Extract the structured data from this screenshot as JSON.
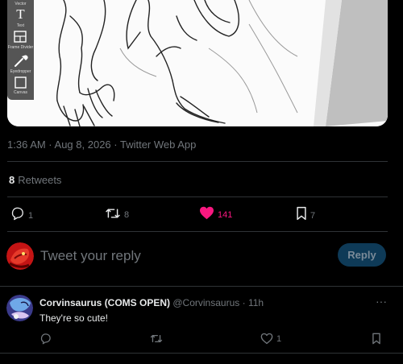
{
  "toolbar": {
    "tools": [
      {
        "label": "Vector",
        "icon": "vector-icon"
      },
      {
        "label": "Text",
        "icon": "text-icon",
        "glyph": "T"
      },
      {
        "label": "Frame Divider",
        "icon": "frame-divider-icon"
      },
      {
        "label": "Eyedropper",
        "icon": "eyedropper-icon"
      },
      {
        "label": "Canvas",
        "icon": "canvas-icon"
      }
    ]
  },
  "tweet": {
    "timestamp": "1:36 AM · Aug 8, 2026 · Twitter Web App",
    "retweet_count": "8",
    "retweet_label": "Retweets",
    "actions": {
      "reply_count": "1",
      "retweet_count": "8",
      "like_count": "141",
      "bookmark_count": "7"
    },
    "like_color": "#f91880"
  },
  "composer": {
    "placeholder": "Tweet your reply",
    "button_label": "Reply"
  },
  "comment": {
    "name": "Corvinsaurus (COMS OPEN)",
    "handle": "@Corvinsaurus",
    "separator": "·",
    "time": "11h",
    "more": "···",
    "text": "They're so cute!",
    "actions": {
      "reply_count": "",
      "retweet_count": "",
      "like_count": "1"
    }
  }
}
